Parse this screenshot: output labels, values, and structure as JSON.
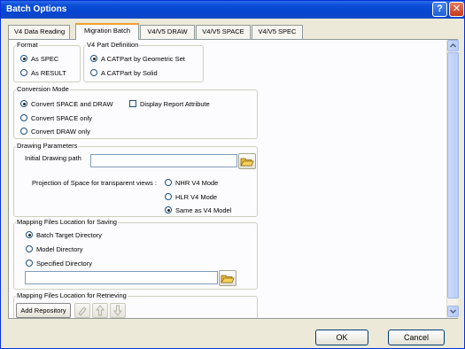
{
  "window": {
    "title": "Batch Options"
  },
  "tabs": [
    {
      "label": "V4 Data Reading",
      "active": false
    },
    {
      "label": "Migration Batch",
      "active": true
    },
    {
      "label": "V4/V5 DRAW",
      "active": false
    },
    {
      "label": "V4/V5 SPACE",
      "active": false
    },
    {
      "label": "V4/V5 SPEC",
      "active": false
    }
  ],
  "format": {
    "title": "Format",
    "options": [
      {
        "label": "As SPEC",
        "selected": true
      },
      {
        "label": "As RESULT",
        "selected": false
      }
    ]
  },
  "v4_part": {
    "title": "V4 Part Definition",
    "options": [
      {
        "label": "A CATPart by Geometric Set",
        "selected": true
      },
      {
        "label": "A CATPart by Solid",
        "selected": false
      }
    ]
  },
  "conversion": {
    "title": "Conversion Mode",
    "options": [
      {
        "label": "Convert SPACE and DRAW",
        "selected": true
      },
      {
        "label": "Convert SPACE only",
        "selected": false
      },
      {
        "label": "Convert DRAW only",
        "selected": false
      }
    ],
    "checkbox_label": "Display Report Attribute",
    "checkbox_checked": false
  },
  "drawing": {
    "title": "Drawing Parameters",
    "path_label": "Initial Drawing path",
    "path_value": "",
    "projection_label": "Projection of Space for transparent views :",
    "options": [
      {
        "label": "NHR V4 Mode",
        "selected": false
      },
      {
        "label": "HLR V4 Mode",
        "selected": false
      },
      {
        "label": "Same as V4 Model",
        "selected": true
      }
    ]
  },
  "mapping_saving": {
    "title": "Mapping Files Location for Saving",
    "options": [
      {
        "label": "Batch Target Directory",
        "selected": true
      },
      {
        "label": "Model Directory",
        "selected": false
      },
      {
        "label": "Specified Directory",
        "selected": false
      }
    ],
    "path_value": ""
  },
  "mapping_retrieving": {
    "title": "Mapping Files Location for Retrieving",
    "add_label": "Add Repository"
  },
  "buttons": {
    "ok": "OK",
    "cancel": "Cancel"
  },
  "icons": {
    "folder": "folder-open-icon",
    "edit": "pencil-icon",
    "up": "arrow-up-icon",
    "down": "arrow-down-icon"
  }
}
